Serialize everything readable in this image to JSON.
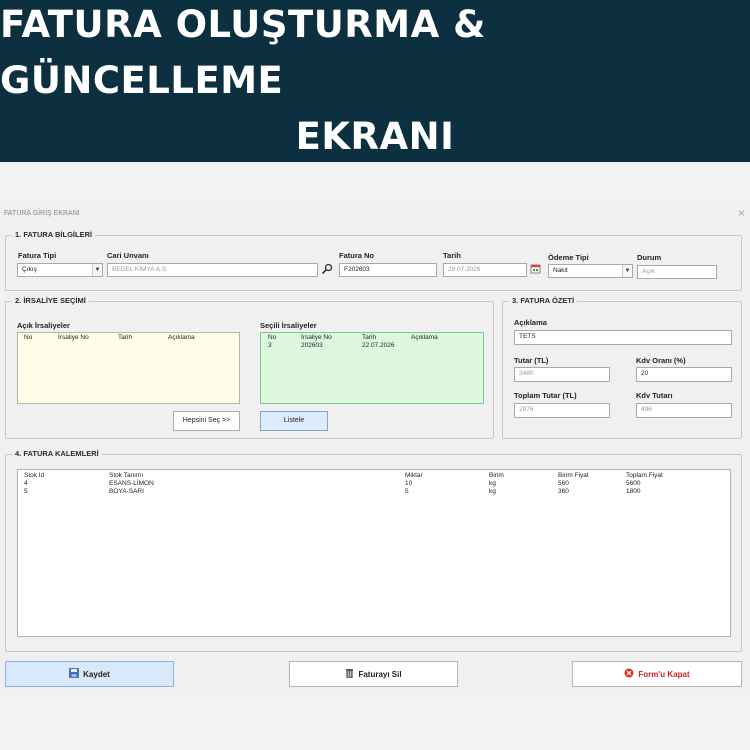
{
  "banner": {
    "line1": "FATURA OLUŞTURMA & GÜNCELLEME",
    "line2": "EKRANI"
  },
  "window": {
    "title": "FATURA GİRİŞ EKRANI",
    "close": "×"
  },
  "invoice_info": {
    "legend": "1. FATURA BİLGİLERİ",
    "fatura_tipi": {
      "label": "Fatura Tipi",
      "value": "Çıkış"
    },
    "cari_unvani": {
      "label": "Cari Unvanı",
      "value": "BEDEL KİMYA A.Ş."
    },
    "fatura_no": {
      "label": "Fatura No",
      "value": "F202603"
    },
    "tarih": {
      "label": "Tarih",
      "value": "28.07.2026"
    },
    "odeme_tipi": {
      "label": "Ödeme Tipi",
      "value": "Nakit"
    },
    "durum": {
      "label": "Durum",
      "value": "Açık"
    }
  },
  "irsaliye": {
    "legend": "2. İRSALİYE SEÇİMİ",
    "open_label": "Açık İrsaliyeler",
    "selected_label": "Seçili İrsaliyeler",
    "columns": [
      "No",
      "İrsaliye No",
      "Tarih",
      "Açıklama"
    ],
    "open_rows": [],
    "selected_rows": [
      {
        "no": "3",
        "irsaliye_no": "202603",
        "tarih": "22.07.2026",
        "aciklama": ""
      }
    ],
    "select_all_label": "Hepsini Seç  >>",
    "list_label": "Listele"
  },
  "summary": {
    "legend": "3. FATURA ÖZETİ",
    "aciklama": {
      "label": "Açıklama",
      "value": "TETS"
    },
    "tutar": {
      "label": "Tutar (TL)",
      "value": "2480"
    },
    "kdv_orani": {
      "label": "Kdv Oranı (%)",
      "value": "20"
    },
    "toplam_tutar": {
      "label": "Toplam Tutar (TL)",
      "value": "2976"
    },
    "kdv_tutari": {
      "label": "Kdv Tutarı",
      "value": "496"
    }
  },
  "items": {
    "legend": "4. FATURA KALEMLERİ",
    "columns": [
      "Stok Id",
      "Stok Tanımı",
      "Miktar",
      "Birim",
      "Birim Fiyat",
      "Toplam Fiyat"
    ],
    "rows": [
      [
        "4",
        "ESANS-LİMON",
        "10",
        "kg",
        "560",
        "5600"
      ],
      [
        "5",
        "BOYA-SARI",
        "5",
        "kg",
        "360",
        "1800"
      ]
    ]
  },
  "actions": {
    "save": "Kaydet",
    "delete": "Faturayı Sil",
    "close": "Form'u Kapat"
  },
  "icons": {
    "search": "search-icon",
    "calendar": "calendar-icon",
    "save": "save-icon",
    "delete": "trash-icon",
    "close": "close-circle-icon"
  },
  "colors": {
    "banner": "#0c3040",
    "open_list_bg": "#fffde8",
    "selected_list_bg": "#ddf7df",
    "selected_list_border": "#7cc98a",
    "close_text": "#d11e1e"
  }
}
